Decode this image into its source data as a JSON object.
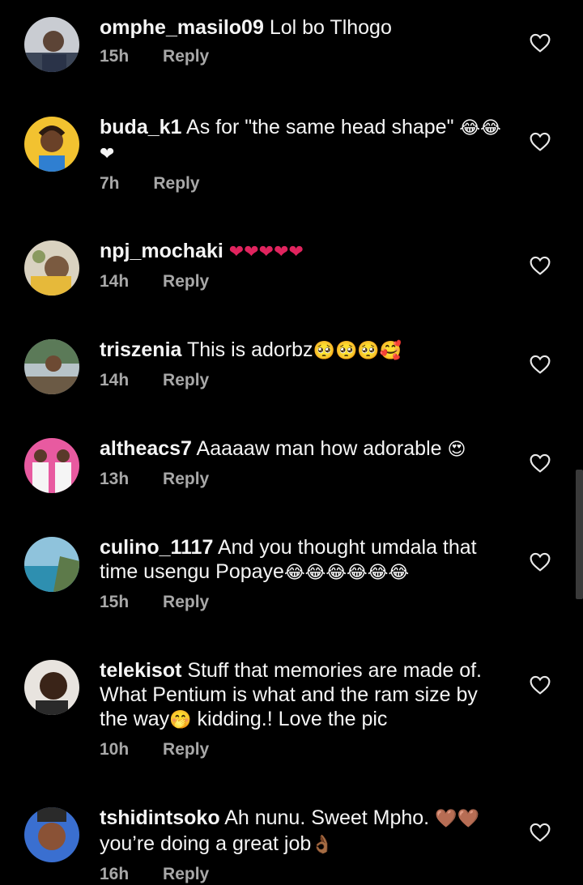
{
  "comments": [
    {
      "username": "omphe_masilo09",
      "text": "Lol bo Tlhogo",
      "emoji": "",
      "time": "15h",
      "reply": "Reply"
    },
    {
      "username": "buda_k1",
      "text": "As for \"the same head shape\"",
      "emoji": "😂😂❤",
      "time": "7h",
      "reply": "Reply"
    },
    {
      "username": "npj_mochaki",
      "text": "",
      "emoji": "❤❤❤❤❤",
      "time": "14h",
      "reply": "Reply"
    },
    {
      "username": "triszenia",
      "text": "This is adorbz",
      "emoji": "🥺🥺🥺🥰",
      "time": "14h",
      "reply": "Reply"
    },
    {
      "username": "altheacs7",
      "text": "Aaaaaw man how adorable",
      "emoji": "😍",
      "time": "13h",
      "reply": "Reply"
    },
    {
      "username": "culino_1117",
      "text": "And you thought umdala that time usengu Popaye",
      "emoji": "😂😂😂😂😂😂",
      "time": "15h",
      "reply": "Reply"
    },
    {
      "username": "telekisot",
      "text": "Stuff that memories are made of. What Pentium is what and the ram size by the way",
      "emoji": "🤭",
      "text_after": "kidding.! Love the pic",
      "time": "10h",
      "reply": "Reply"
    },
    {
      "username": "tshidintsoko",
      "text": "Ah nunu. Sweet Mpho.",
      "emoji": "🤎🤎",
      "text_after": "you’re doing a great job",
      "emoji_after": "👌🏾",
      "time": "16h",
      "reply": "Reply"
    }
  ],
  "colors": {
    "background": "#000000",
    "text": "#f5f5f5",
    "meta": "#a8a8a8"
  }
}
